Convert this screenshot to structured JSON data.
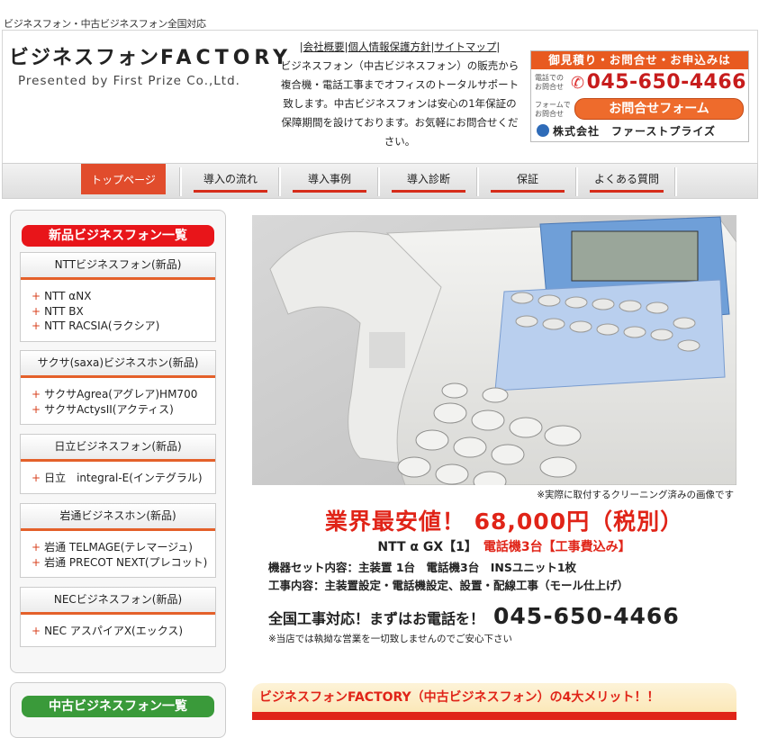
{
  "topline": "ビジネスフォン・中古ビジネスフォン全国対応",
  "logo": {
    "title_jp": "ビジネスフォン",
    "title_en": "FACTORY",
    "sub": "Presented by First Prize Co.,Ltd."
  },
  "header_links": [
    "会社概要",
    "個人情報保護方針",
    "サイトマップ"
  ],
  "intro": "ビジネスフォン（中古ビジネスフォン）の販売から複合機・電話工事までオフィスのトータルサポート致します。中古ビジネスフォンは安心の1年保証の保障期間を設けております。お気軽にお問合せください。",
  "contact": {
    "bar": "御見積り・お問合せ・お申込みは",
    "tel_label": "電話での お問合せ",
    "tel": "045-650-4466",
    "form_label": "フォームで お問合せ",
    "form_button": "お問合せフォーム",
    "company": "株式会社　ファーストプライズ"
  },
  "nav": [
    {
      "label": "トップページ",
      "active": true
    },
    {
      "label": "導入の流れ",
      "active": false
    },
    {
      "label": "導入事例",
      "active": false
    },
    {
      "label": "導入診断",
      "active": false
    },
    {
      "label": "保証",
      "active": false
    },
    {
      "label": "よくある質問",
      "active": false
    }
  ],
  "sidebar": {
    "new_title": "新品ビジネスフォン一覧",
    "categories": [
      {
        "heading": "NTTビジネスフォン(新品)",
        "items": [
          "NTT αNX",
          "NTT BX",
          "NTT RACSIA(ラクシア)"
        ]
      },
      {
        "heading": "サクサ(saxa)ビジネスホン(新品)",
        "items": [
          "サクサAgrea(アグレア)HM700",
          "サクサActysII(アクティス)"
        ]
      },
      {
        "heading": "日立ビジネスフォン(新品)",
        "items": [
          "日立　integral-E(インテグラル)"
        ]
      },
      {
        "heading": "岩通ビジネスホン(新品)",
        "items": [
          "岩通 TELMAGE(テレマージュ)",
          "岩通 PRECOT NEXT(プレコット)"
        ]
      },
      {
        "heading": "NECビジネスフォン(新品)",
        "items": [
          "NEC アスパイアX(エックス)"
        ]
      }
    ],
    "used_title": "中古ビジネスフォン一覧"
  },
  "main": {
    "caption": "※実際に取付するクリーニング済みの画像です",
    "price": "業界最安値！ 68,000円（税別）",
    "model_black": "NTT α GX【1】",
    "model_red": "電話機3台【工事費込み】",
    "detail1": "機器セット内容：主装置 1台　電話機3台　INSユニット1枚",
    "detail2": "工事内容：主装置設定・電話機設定、設置・配線工事（モール仕上げ）",
    "call_text": "全国工事対応！まずはお電話を！",
    "call_number": "045-650-4466",
    "note": "※当店では執拗な営業を一切致しませんのでご安心下さい",
    "merit": "ビジネスフォンFACTORY（中古ビジネスフォン）の4大メリット！！"
  },
  "colors": {
    "accent_red": "#e02418",
    "nav_active": "#e14c2c",
    "green_title": "#3a9a3a",
    "red_title": "#e8151a"
  }
}
